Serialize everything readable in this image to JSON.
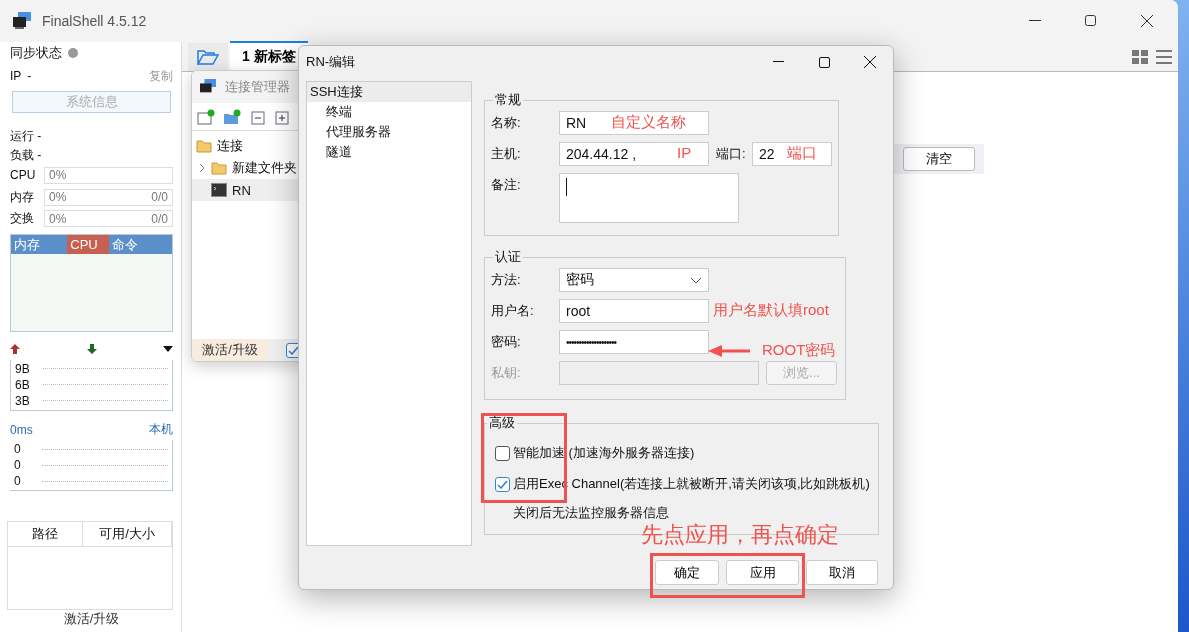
{
  "window": {
    "title": "FinalShell 4.5.12"
  },
  "sidebar": {
    "sync_label": "同步状态",
    "ip_label": "IP",
    "ip_value": "-",
    "copy_link": "复制",
    "sysinfo_button": "系统信息",
    "uptime": "运行 -",
    "load": "负载 -",
    "meters": [
      {
        "label": "CPU",
        "percent": "0%",
        "level": 0
      },
      {
        "label": "内存",
        "percent": "0%",
        "amount": "0/0",
        "level": 0
      },
      {
        "label": "交换",
        "percent": "0%",
        "amount": "0/0",
        "level": 0
      }
    ],
    "process_columns": [
      {
        "label": "内存",
        "selected": false
      },
      {
        "label": "CPU",
        "selected": true
      },
      {
        "label": "命令",
        "selected": false
      }
    ],
    "net_ticks": [
      "9B",
      "6B",
      "3B"
    ],
    "latency": "0ms",
    "host_label": "本机",
    "latency_ticks": [
      "0",
      "0",
      "0"
    ],
    "disk_columns": [
      "路径",
      "可用/大小"
    ],
    "activate_link": "激活/升级"
  },
  "tabs": [
    {
      "label": "1 新标签",
      "selected": true
    }
  ],
  "clear_button": "清空",
  "connection_manager": {
    "title": "连接管理器",
    "tree": [
      {
        "label": "连接",
        "kind": "folder",
        "selected": false,
        "children": [
          {
            "label": "新建文件夹",
            "kind": "folder",
            "selected": false,
            "expanded": false
          },
          {
            "label": "RN",
            "kind": "server",
            "selected": true
          }
        ]
      }
    ],
    "activate_button": "激活/升级",
    "checked": true
  },
  "dialog": {
    "title": "RN-编辑",
    "nav": [
      {
        "label": "SSH连接",
        "selected": true,
        "children": [
          {
            "label": "终端",
            "selected": false
          },
          {
            "label": "代理服务器",
            "selected": false
          },
          {
            "label": "隧道",
            "selected": false
          }
        ]
      }
    ],
    "general": {
      "legend": "常规",
      "name_label": "名称:",
      "name_value": "RN",
      "host_label": "主机:",
      "host_value": "204.44.12 ,",
      "port_label": "端口:",
      "port_value": "22",
      "note_label": "备注:"
    },
    "auth": {
      "legend": "认证",
      "method_label": "方法:",
      "method_value": "密码",
      "user_label": "用户名:",
      "user_value": "root",
      "password_label": "密码:",
      "password_value": "••••••••••••••••••••",
      "key_label": "私钥:",
      "browse_button": "浏览...",
      "key_disabled": true
    },
    "advanced": {
      "legend": "高级",
      "options": [
        {
          "label": "智能加速 (加速海外服务器连接)",
          "checked": false
        },
        {
          "label": "启用Exec Channel(若连接上就被断开,请关闭该项,比如跳板机)",
          "checked": true
        }
      ],
      "note": "关闭后无法监控服务器信息"
    },
    "buttons": [
      "确定",
      "应用",
      "取消"
    ]
  },
  "annotations": {
    "name_hint": "自定义名称",
    "host_hint": "IP",
    "port_hint": "端口",
    "user_hint": "用户名默认填root",
    "password_hint": "ROOT密码",
    "steps": "先点应用，再点确定"
  }
}
